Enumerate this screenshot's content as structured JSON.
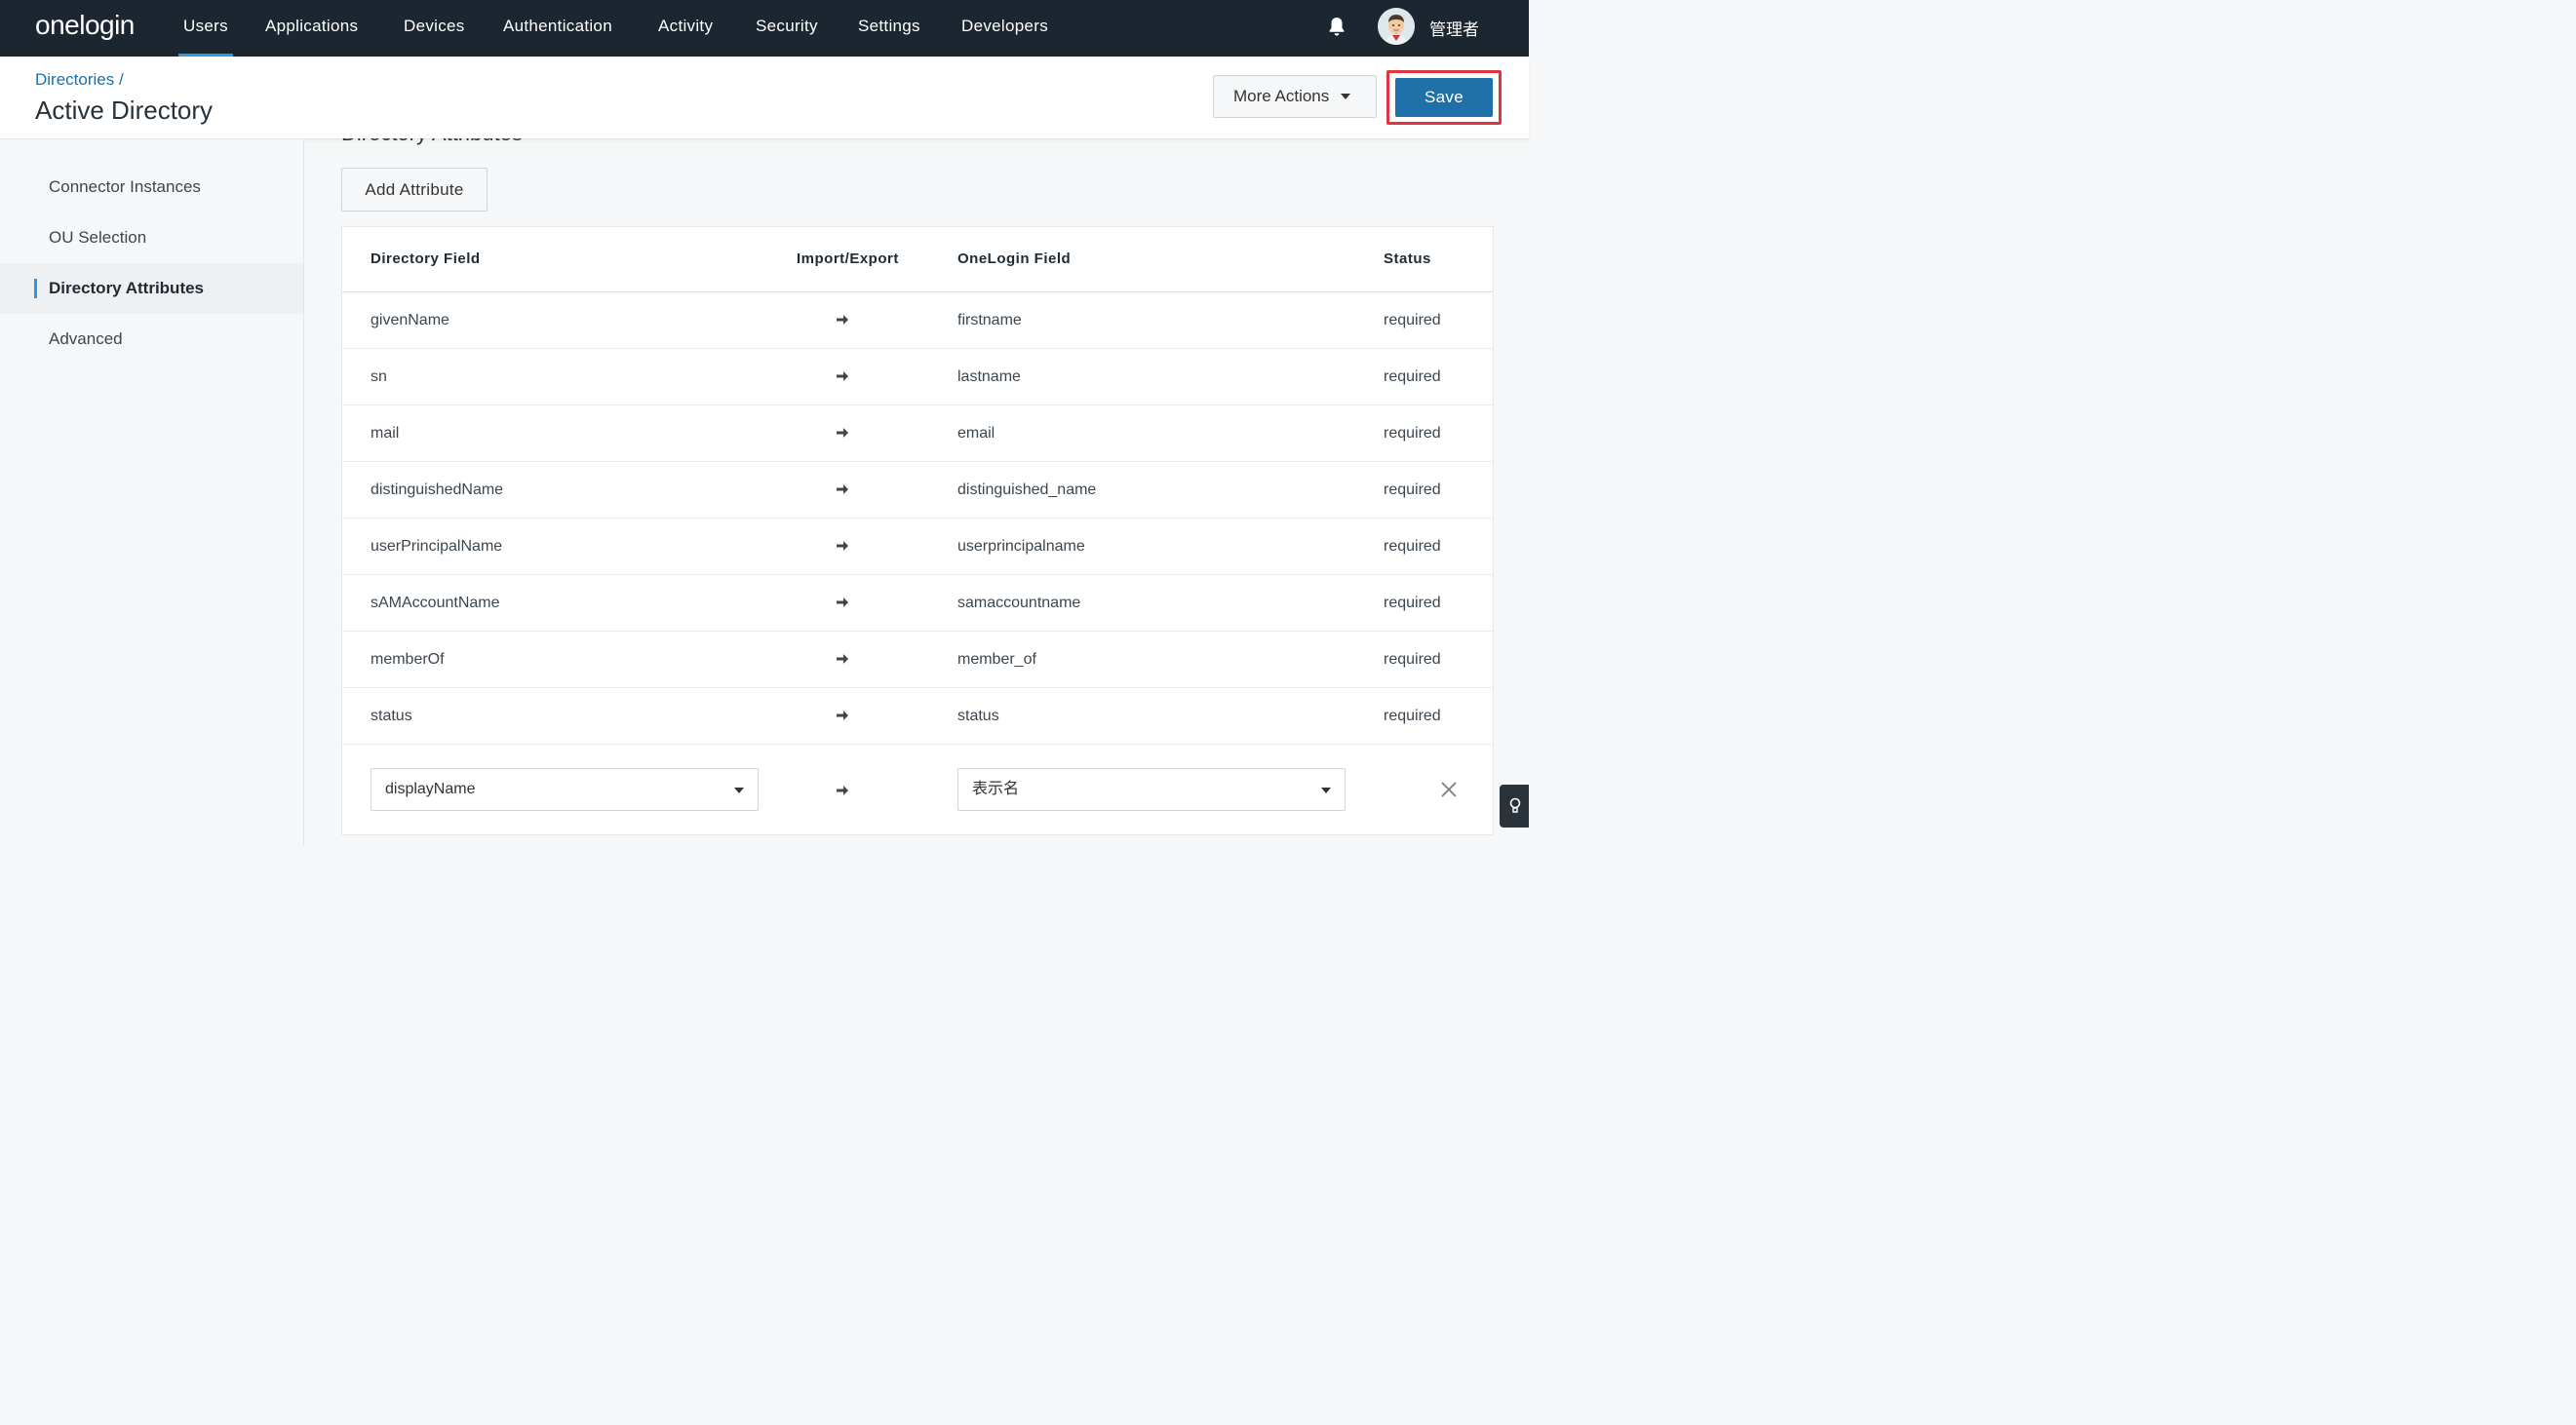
{
  "brand": {
    "logo": "onelogin"
  },
  "nav": {
    "items": [
      "Users",
      "Applications",
      "Devices",
      "Authentication",
      "Activity",
      "Security",
      "Settings",
      "Developers"
    ],
    "active": "Users",
    "user_name": "管理者"
  },
  "header": {
    "breadcrumb": "Directories /",
    "title": "Active Directory",
    "more_actions_label": "More Actions",
    "save_label": "Save"
  },
  "sidebar": {
    "items": [
      {
        "label": "Connector Instances"
      },
      {
        "label": "OU Selection"
      },
      {
        "label": "Directory Attributes"
      },
      {
        "label": "Advanced"
      }
    ],
    "active": "Directory Attributes"
  },
  "main": {
    "section_title": "Directory Attributes",
    "add_attribute_label": "Add Attribute",
    "table": {
      "headers": [
        "Directory Field",
        "Import/Export",
        "OneLogin Field",
        "Status"
      ],
      "rows": [
        {
          "directory": "givenName",
          "onelogin": "firstname",
          "status": "required"
        },
        {
          "directory": "sn",
          "onelogin": "lastname",
          "status": "required"
        },
        {
          "directory": "mail",
          "onelogin": "email",
          "status": "required"
        },
        {
          "directory": "distinguishedName",
          "onelogin": "distinguished_name",
          "status": "required"
        },
        {
          "directory": "userPrincipalName",
          "onelogin": "userprincipalname",
          "status": "required"
        },
        {
          "directory": "sAMAccountName",
          "onelogin": "samaccountname",
          "status": "required"
        },
        {
          "directory": "memberOf",
          "onelogin": "member_of",
          "status": "required"
        },
        {
          "directory": "status",
          "onelogin": "status",
          "status": "required"
        }
      ],
      "editable_row": {
        "directory_value": "displayName",
        "onelogin_value": "表示名"
      }
    }
  },
  "colors": {
    "nav_bg": "#1c2630",
    "accent": "#2f9bd6",
    "primary_button": "#1f6fa8",
    "highlight_border": "#e0353f"
  },
  "icons": [
    "bell-icon",
    "avatar",
    "chevron-down-icon",
    "arrow-right-icon",
    "close-icon",
    "lightbulb-icon"
  ]
}
